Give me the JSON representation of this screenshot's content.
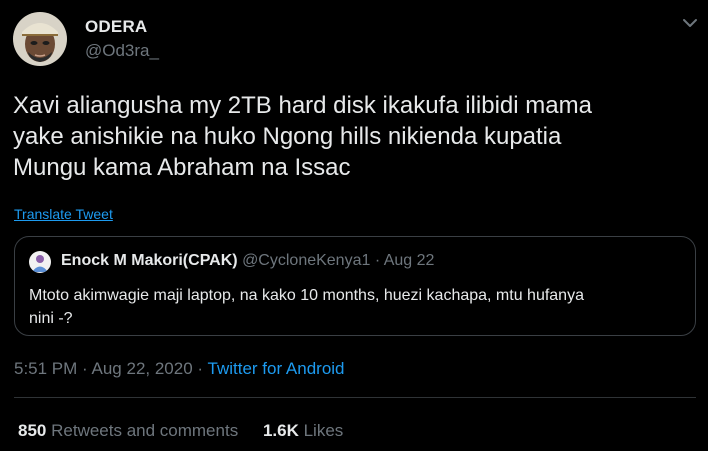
{
  "author": {
    "display_name": "ODERA",
    "handle": "@Od3ra_"
  },
  "tweet": {
    "lines": [
      "Xavi aliangusha my 2TB hard disk ikakufa ilibidi mama",
      "yake anishikie  na huko Ngong hills nikienda kupatia",
      "Mungu kama Abraham na Issac"
    ],
    "translate_label": "Translate Tweet"
  },
  "quoted_tweet": {
    "display_name": "Enock M Makori(CPAK)",
    "handle": "@CycloneKenya1",
    "separator": "·",
    "date": "Aug 22",
    "lines": [
      "Mtoto akimwagie maji laptop, na kako 10 months, huezi kachapa, mtu hufanya",
      "nini -?"
    ]
  },
  "meta": {
    "time": "5:51 PM",
    "separator": "·",
    "date": "Aug 22, 2020",
    "source": "Twitter for Android"
  },
  "stats": {
    "retweets_count": "850",
    "retweets_label": "Retweets and comments",
    "likes_count": "1.6K",
    "likes_label": "Likes"
  },
  "icons": {
    "caret": "chevron-down-icon"
  },
  "colors": {
    "background": "#000000",
    "text": "#e7e9ea",
    "secondary": "#6e767d",
    "link": "#1d9bf0",
    "border": "#3a3f44"
  }
}
